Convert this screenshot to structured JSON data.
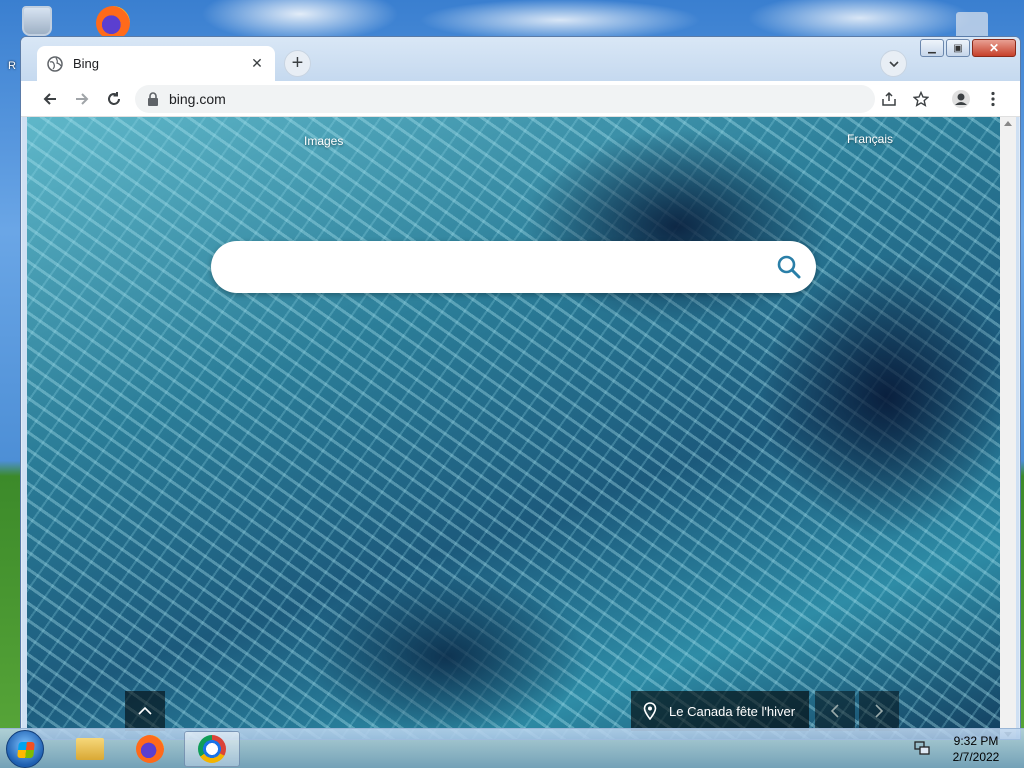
{
  "browser": {
    "tab": {
      "title": "Bing"
    },
    "address_bar": {
      "url": "bing.com"
    }
  },
  "page": {
    "links": {
      "images": "Images",
      "language": "Français"
    },
    "search": {
      "value": "",
      "placeholder": ""
    },
    "image_caption": "Le Canada fête l'hiver"
  },
  "taskbar": {
    "clock_time": "9:32 PM",
    "clock_date": "2/7/2022"
  },
  "desktop": {
    "partial_label": "R"
  },
  "colors": {
    "accent": "#0078d4",
    "bing_search_icon": "#2a7fa8",
    "window_frame": "#cfe0f3"
  }
}
